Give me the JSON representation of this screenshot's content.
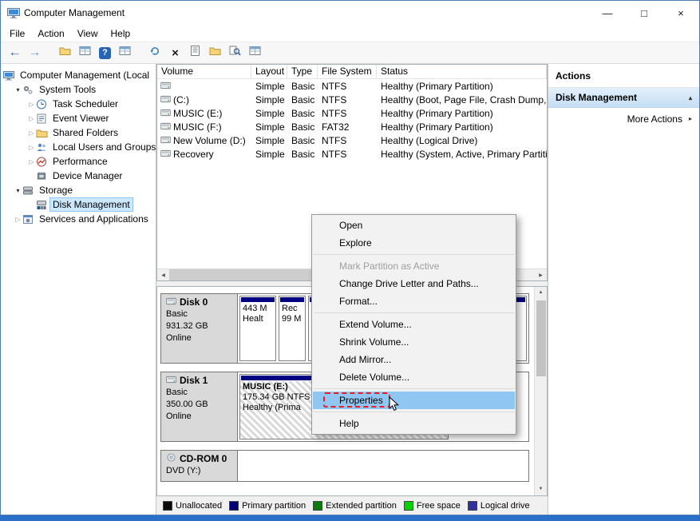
{
  "window": {
    "title": "Computer Management",
    "controls": {
      "minimize": "—",
      "maximize": "□",
      "close": "×"
    }
  },
  "taskbar_color": "#2a70c9",
  "menubar": [
    "File",
    "Action",
    "View",
    "Help"
  ],
  "toolbar": {
    "buttons": [
      "back",
      "forward",
      "show-console-tree",
      "export-list",
      "help",
      "show-action-pane",
      "refresh",
      "delete",
      "properties",
      "open-folder",
      "find",
      "help-topics"
    ]
  },
  "glyphs": {
    "back_arrow": "←",
    "forward_arrow": "→",
    "delete_x": "×",
    "help": "?",
    "expanded": "▾",
    "collapsed": "▷",
    "scroll_up": "▲",
    "scroll_down": "▼",
    "scroll_left": "◀",
    "scroll_right": "▶",
    "panel_collapse": "▴",
    "submenu": "▸"
  },
  "tree": {
    "items": [
      {
        "label": "Computer Management (Local"
      },
      {
        "label": "System Tools"
      },
      {
        "label": "Task Scheduler"
      },
      {
        "label": "Event Viewer"
      },
      {
        "label": "Shared Folders"
      },
      {
        "label": "Local Users and Groups"
      },
      {
        "label": "Performance"
      },
      {
        "label": "Device Manager"
      },
      {
        "label": "Storage"
      },
      {
        "label": "Disk Management"
      },
      {
        "label": "Services and Applications"
      }
    ]
  },
  "volumes": {
    "columns": [
      "Volume",
      "Layout",
      "Type",
      "File System",
      "Status"
    ],
    "rows": [
      [
        "",
        "Simple",
        "Basic",
        "NTFS",
        "Healthy (Primary Partition)"
      ],
      [
        "(C:)",
        "Simple",
        "Basic",
        "NTFS",
        "Healthy (Boot, Page File, Crash Dump, P"
      ],
      [
        "MUSIC (E:)",
        "Simple",
        "Basic",
        "NTFS",
        "Healthy (Primary Partition)"
      ],
      [
        "MUSIC (F:)",
        "Simple",
        "Basic",
        "FAT32",
        "Healthy (Primary Partition)"
      ],
      [
        "New Volume (D:)",
        "Simple",
        "Basic",
        "NTFS",
        "Healthy (Logical Drive)"
      ],
      [
        "Recovery",
        "Simple",
        "Basic",
        "NTFS",
        "Healthy (System, Active, Primary Partiti"
      ]
    ]
  },
  "partition_strip_color": "#000082",
  "disk_graph": {
    "disks": [
      {
        "name": "Disk 0",
        "kind": "Basic",
        "size": "931.32 GB",
        "state": "Online",
        "parts": [
          [
            "443 M",
            "Healt"
          ],
          [
            "Rec",
            "99 M"
          ]
        ]
      },
      {
        "name": "Disk 1",
        "kind": "Basic",
        "size": "350.00 GB",
        "state": "Online",
        "parts": [
          [
            "MUSIC (E:)",
            "175.34 GB NTFS",
            "Healthy (Prima"
          ]
        ]
      },
      {
        "name": "CD-ROM 0",
        "kind": "DVD (Y:)"
      }
    ]
  },
  "legend": {
    "items": [
      {
        "label": "Unallocated",
        "color": "#0a0a0a"
      },
      {
        "label": "Primary partition",
        "color": "#000078"
      },
      {
        "label": "Extended partition",
        "color": "#0b7a0b"
      },
      {
        "label": "Free space",
        "color": "#00d400"
      },
      {
        "label": "Logical drive",
        "color": "#2f2f9e"
      }
    ]
  },
  "actions": {
    "title": "Actions",
    "primary": "Disk Management",
    "more": "More Actions"
  },
  "context_menu": {
    "highlight_color": "#8fc6f2",
    "annotation_color": "#ed1c24",
    "items": [
      "Open",
      "Explore",
      "Mark Partition as Active",
      "Change Drive Letter and Paths...",
      "Format...",
      "Extend Volume...",
      "Shrink Volume...",
      "Add Mirror...",
      "Delete Volume...",
      "Properties",
      "Help"
    ]
  }
}
